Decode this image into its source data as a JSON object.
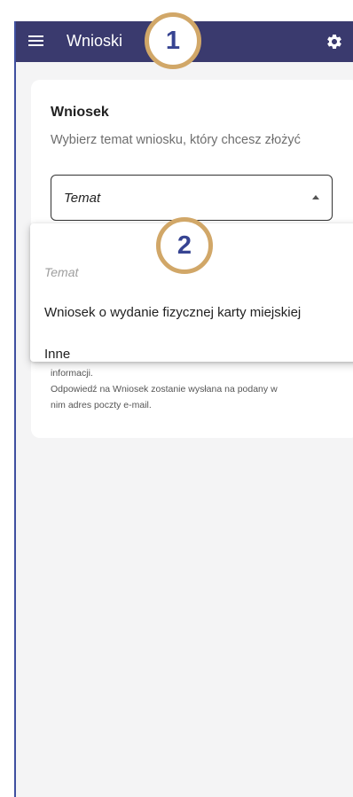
{
  "appbar": {
    "title": "Wnioski",
    "menu_icon": "hamburger-menu-icon",
    "settings_icon": "gear-icon"
  },
  "card": {
    "title": "Wniosek",
    "subtitle": "Wybierz temat wniosku, który chcesz złożyć",
    "select": {
      "label": "Temat",
      "caret_icon": "caret-up-icon"
    },
    "info_lines": [
      "informacji.",
      "Odpowiedź na Wniosek zostanie wysłana na podany w",
      "nim adres poczty e-mail."
    ]
  },
  "dropdown": {
    "placeholder": "Temat",
    "options": [
      "Wniosek o wydanie fizycznej karty miejskiej",
      "Inne"
    ]
  },
  "badges": [
    "1",
    "2"
  ],
  "colors": {
    "appbar": "#3a3a6e",
    "badge_ring": "#d1a768",
    "badge_text": "#374492",
    "screen_bg": "#f4f4f5"
  }
}
